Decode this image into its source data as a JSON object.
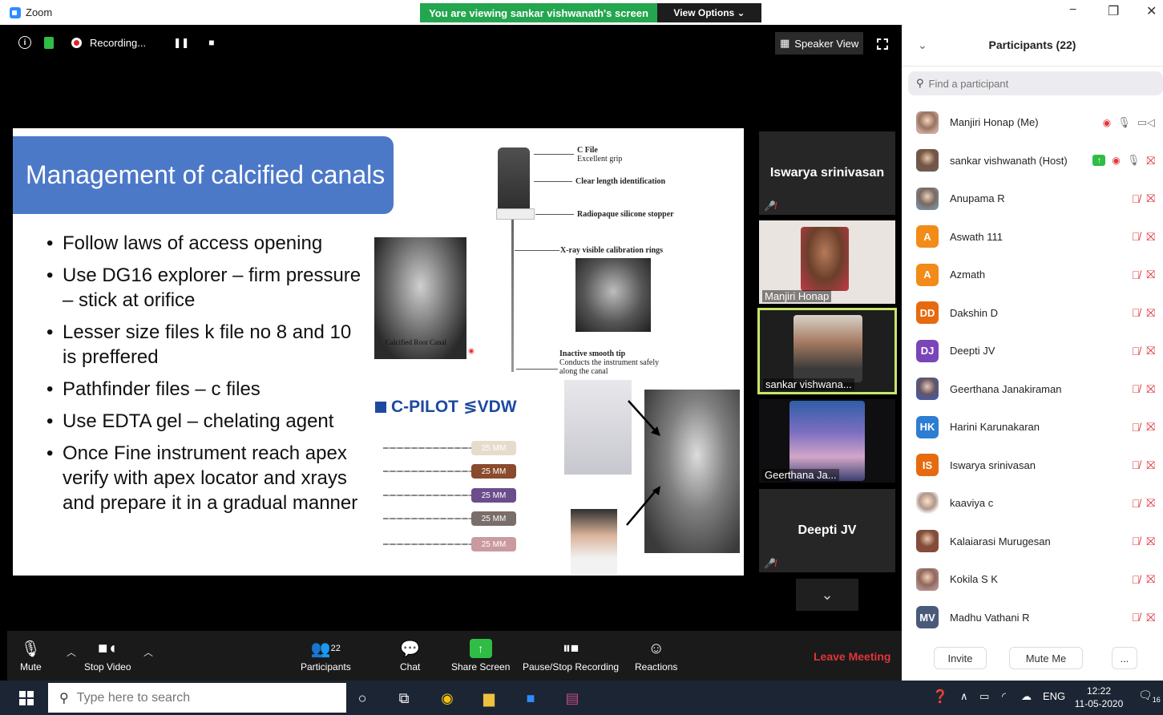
{
  "titlebar": {
    "app_name": "Zoom",
    "viewing_banner": "You are viewing sankar vishwanath's screen",
    "view_options": "View Options ⌄",
    "minimize": "−",
    "restore": "❐",
    "close": "✕"
  },
  "meeting_top": {
    "recording_label": "Recording...",
    "speaker_view": "Speaker View"
  },
  "slide": {
    "title": "Management of calcified canals",
    "bullets": [
      "Follow laws of access opening",
      "Use DG16 explorer – firm pressure – stick at orifice",
      "Lesser size files k file no 8 and 10 is preffered",
      "Pathfinder files – c files",
      "Use EDTA gel – chelating agent",
      "Once Fine instrument reach apex verify with apex locator and xrays and prepare it in a gradual manner"
    ],
    "xray_caption": "Calcified Root Canal",
    "diagram_labels": {
      "c_file": "C File",
      "excellent_grip": "Excellent grip",
      "clear_length": "Clear length identification",
      "radiopaque": "Radiopaque silicone stopper",
      "calibration": "X-ray visible calibration rings",
      "smooth_tip": "Inactive smooth tip",
      "conducts": "Conducts the instrument safely",
      "along_canal": "along the canal"
    },
    "brand": "C-PILOT",
    "brand2": "≶VDW",
    "file_sizes": [
      "25 MM",
      "25 MM",
      "25 MM",
      "25 MM",
      "25 MM"
    ],
    "file_colors": [
      "#e7dccb",
      "#8a4a2c",
      "#6b4d8c",
      "#7a6d6a",
      "#c99aa0"
    ]
  },
  "gallery": [
    {
      "name": "Iswarya srinivasan",
      "style": "big"
    },
    {
      "name": "Manjiri Honap",
      "style": "small"
    },
    {
      "name": "sankar vishwana...",
      "style": "small"
    },
    {
      "name": "Geerthana Ja...",
      "style": "small"
    },
    {
      "name": "Deepti JV",
      "style": "big"
    }
  ],
  "controls": {
    "mute": "Mute",
    "stop_video": "Stop Video",
    "participants": "Participants",
    "participants_count": "22",
    "chat": "Chat",
    "share_screen": "Share Screen",
    "pause_recording": "Pause/Stop Recording",
    "reactions": "Reactions",
    "leave": "Leave Meeting"
  },
  "participants_panel": {
    "title": "Participants (22)",
    "search_placeholder": "Find a participant",
    "invite": "Invite",
    "mute_me": "Mute Me",
    "more": "...",
    "list": [
      {
        "name": "Manjiri Honap (Me)",
        "initials": "",
        "color": "#c9a79a"
      },
      {
        "name": "sankar vishwanath (Host)",
        "initials": "",
        "color": "#6d5b4f"
      },
      {
        "name": "Anupama R",
        "initials": "",
        "color": "#7a8a96"
      },
      {
        "name": "Aswath 111",
        "initials": "A",
        "color": "#f28b17"
      },
      {
        "name": "Azmath",
        "initials": "A",
        "color": "#f28b17"
      },
      {
        "name": "Dakshin D",
        "initials": "DD",
        "color": "#e66a0f"
      },
      {
        "name": "Deepti JV",
        "initials": "DJ",
        "color": "#7a45b8"
      },
      {
        "name": "Geerthana Janakiraman",
        "initials": "",
        "color": "#4a5a9a"
      },
      {
        "name": "Harini Karunakaran",
        "initials": "HK",
        "color": "#2d7dd2"
      },
      {
        "name": "Iswarya srinivasan",
        "initials": "IS",
        "color": "#e66a0f"
      },
      {
        "name": "kaaviya c",
        "initials": "",
        "color": "#ffffff"
      },
      {
        "name": "Kalaiarasi Murugesan",
        "initials": "",
        "color": "#8a4a3a"
      },
      {
        "name": "Kokila S K",
        "initials": "",
        "color": "#b08a8a"
      },
      {
        "name": "Madhu Vathani R",
        "initials": "MV",
        "color": "#4a5a7a"
      }
    ]
  },
  "taskbar": {
    "search_placeholder": "Type here to search",
    "lang": "ENG",
    "time": "12:22",
    "date": "11-05-2020",
    "notif_count": "16"
  }
}
